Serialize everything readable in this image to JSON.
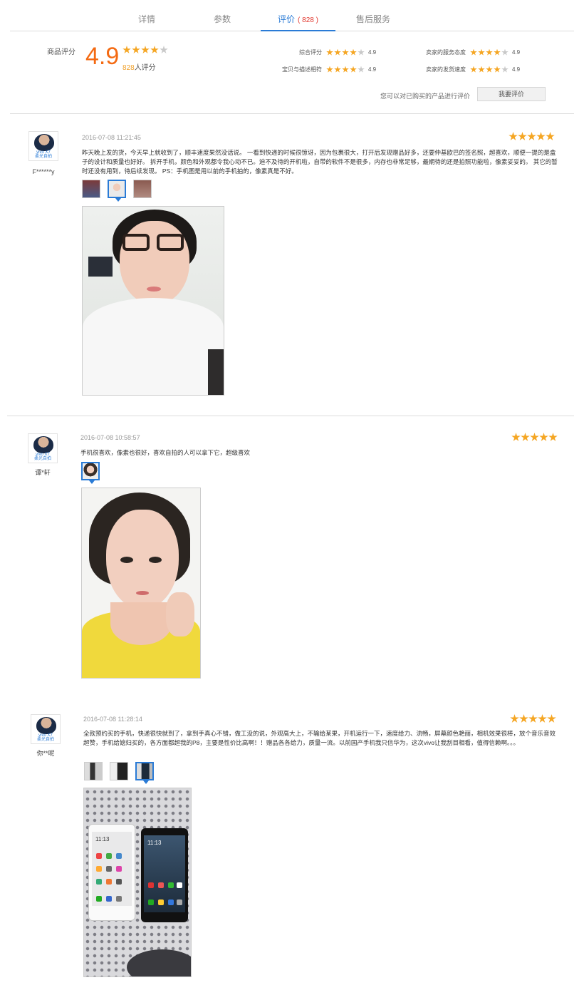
{
  "tabs": [
    {
      "label": "详情"
    },
    {
      "label": "参数"
    },
    {
      "label": "评价",
      "count": "( 828 )"
    },
    {
      "label": "售后服务"
    }
  ],
  "summary": {
    "label": "商品评分",
    "score": "4.9",
    "rater_count": "828",
    "rater_suffix": "人评分",
    "stars": 4,
    "metrics": [
      {
        "label": "综合评分",
        "value": "4.9",
        "stars": 4
      },
      {
        "label": "宝贝与描述相符",
        "value": "4.9",
        "stars": 4
      },
      {
        "label": "卖家的服务态度",
        "value": "4.9",
        "stars": 4
      },
      {
        "label": "卖家的发货速度",
        "value": "4.9",
        "stars": 4
      }
    ],
    "eval_tip": "您可以对已购买的产品进行评价",
    "eval_button": "我要评价"
  },
  "avatar_brand": "vivo X7",
  "avatar_sub": "柔光自拍",
  "reviews": [
    {
      "user": "F******y",
      "date": "2016-07-08 11:21:45",
      "stars": 5,
      "text": "昨天晚上发的货，今天早上就收到了，顺丰速度果然没话说。 一看到快递的时候很惊讶，因为包裹很大，打开后发现赠品好多，还要仲基欧巴的签名照，超喜欢，顺便一提的是盒子的设计和质量也好好。 拆开手机，颜色和外观都令我心动不已。迫不及待的开机啦，自带的软件不是很多，内存也非常足够，最期待的还是拍照功能啦，像素妥妥的。 其它的暂时还没有用到，待后续发现。 PS：手机图是用以前的手机拍的，像素真是不好。",
      "thumbs": 3,
      "selected": 1
    },
    {
      "user": "谭*轩",
      "date": "2016-07-08 10:58:57",
      "stars": 5,
      "text": "手机很喜欢，像素也很好，喜欢自拍的人可以拿下它，超级喜欢",
      "thumbs": 1,
      "selected": 0
    },
    {
      "user": "你**呢",
      "date": "2016-07-08 11:28:14",
      "stars": 5,
      "text": "全款预约买的手机，快递很快就到了，拿到手真心不错，做工没的说，外观高大上，不输给某果，开机运行一下，速度给力、流畅，屏幕颜色艳丽，相机效果很棒，放个音乐音效超赞，手机给媳妇买的，各方面都超我的P8，主要是性价比高啊！！赠品各各给力，质量一流。以前国产手机我只信华为，这次vivo让我刮目相看，值得信赖啊。。。",
      "thumbs": 3,
      "selected": 2
    }
  ],
  "photo_time": "11:13",
  "colors": {
    "accent": "#2a7bd6",
    "score": "#f46a12",
    "star": "#f5a623"
  }
}
